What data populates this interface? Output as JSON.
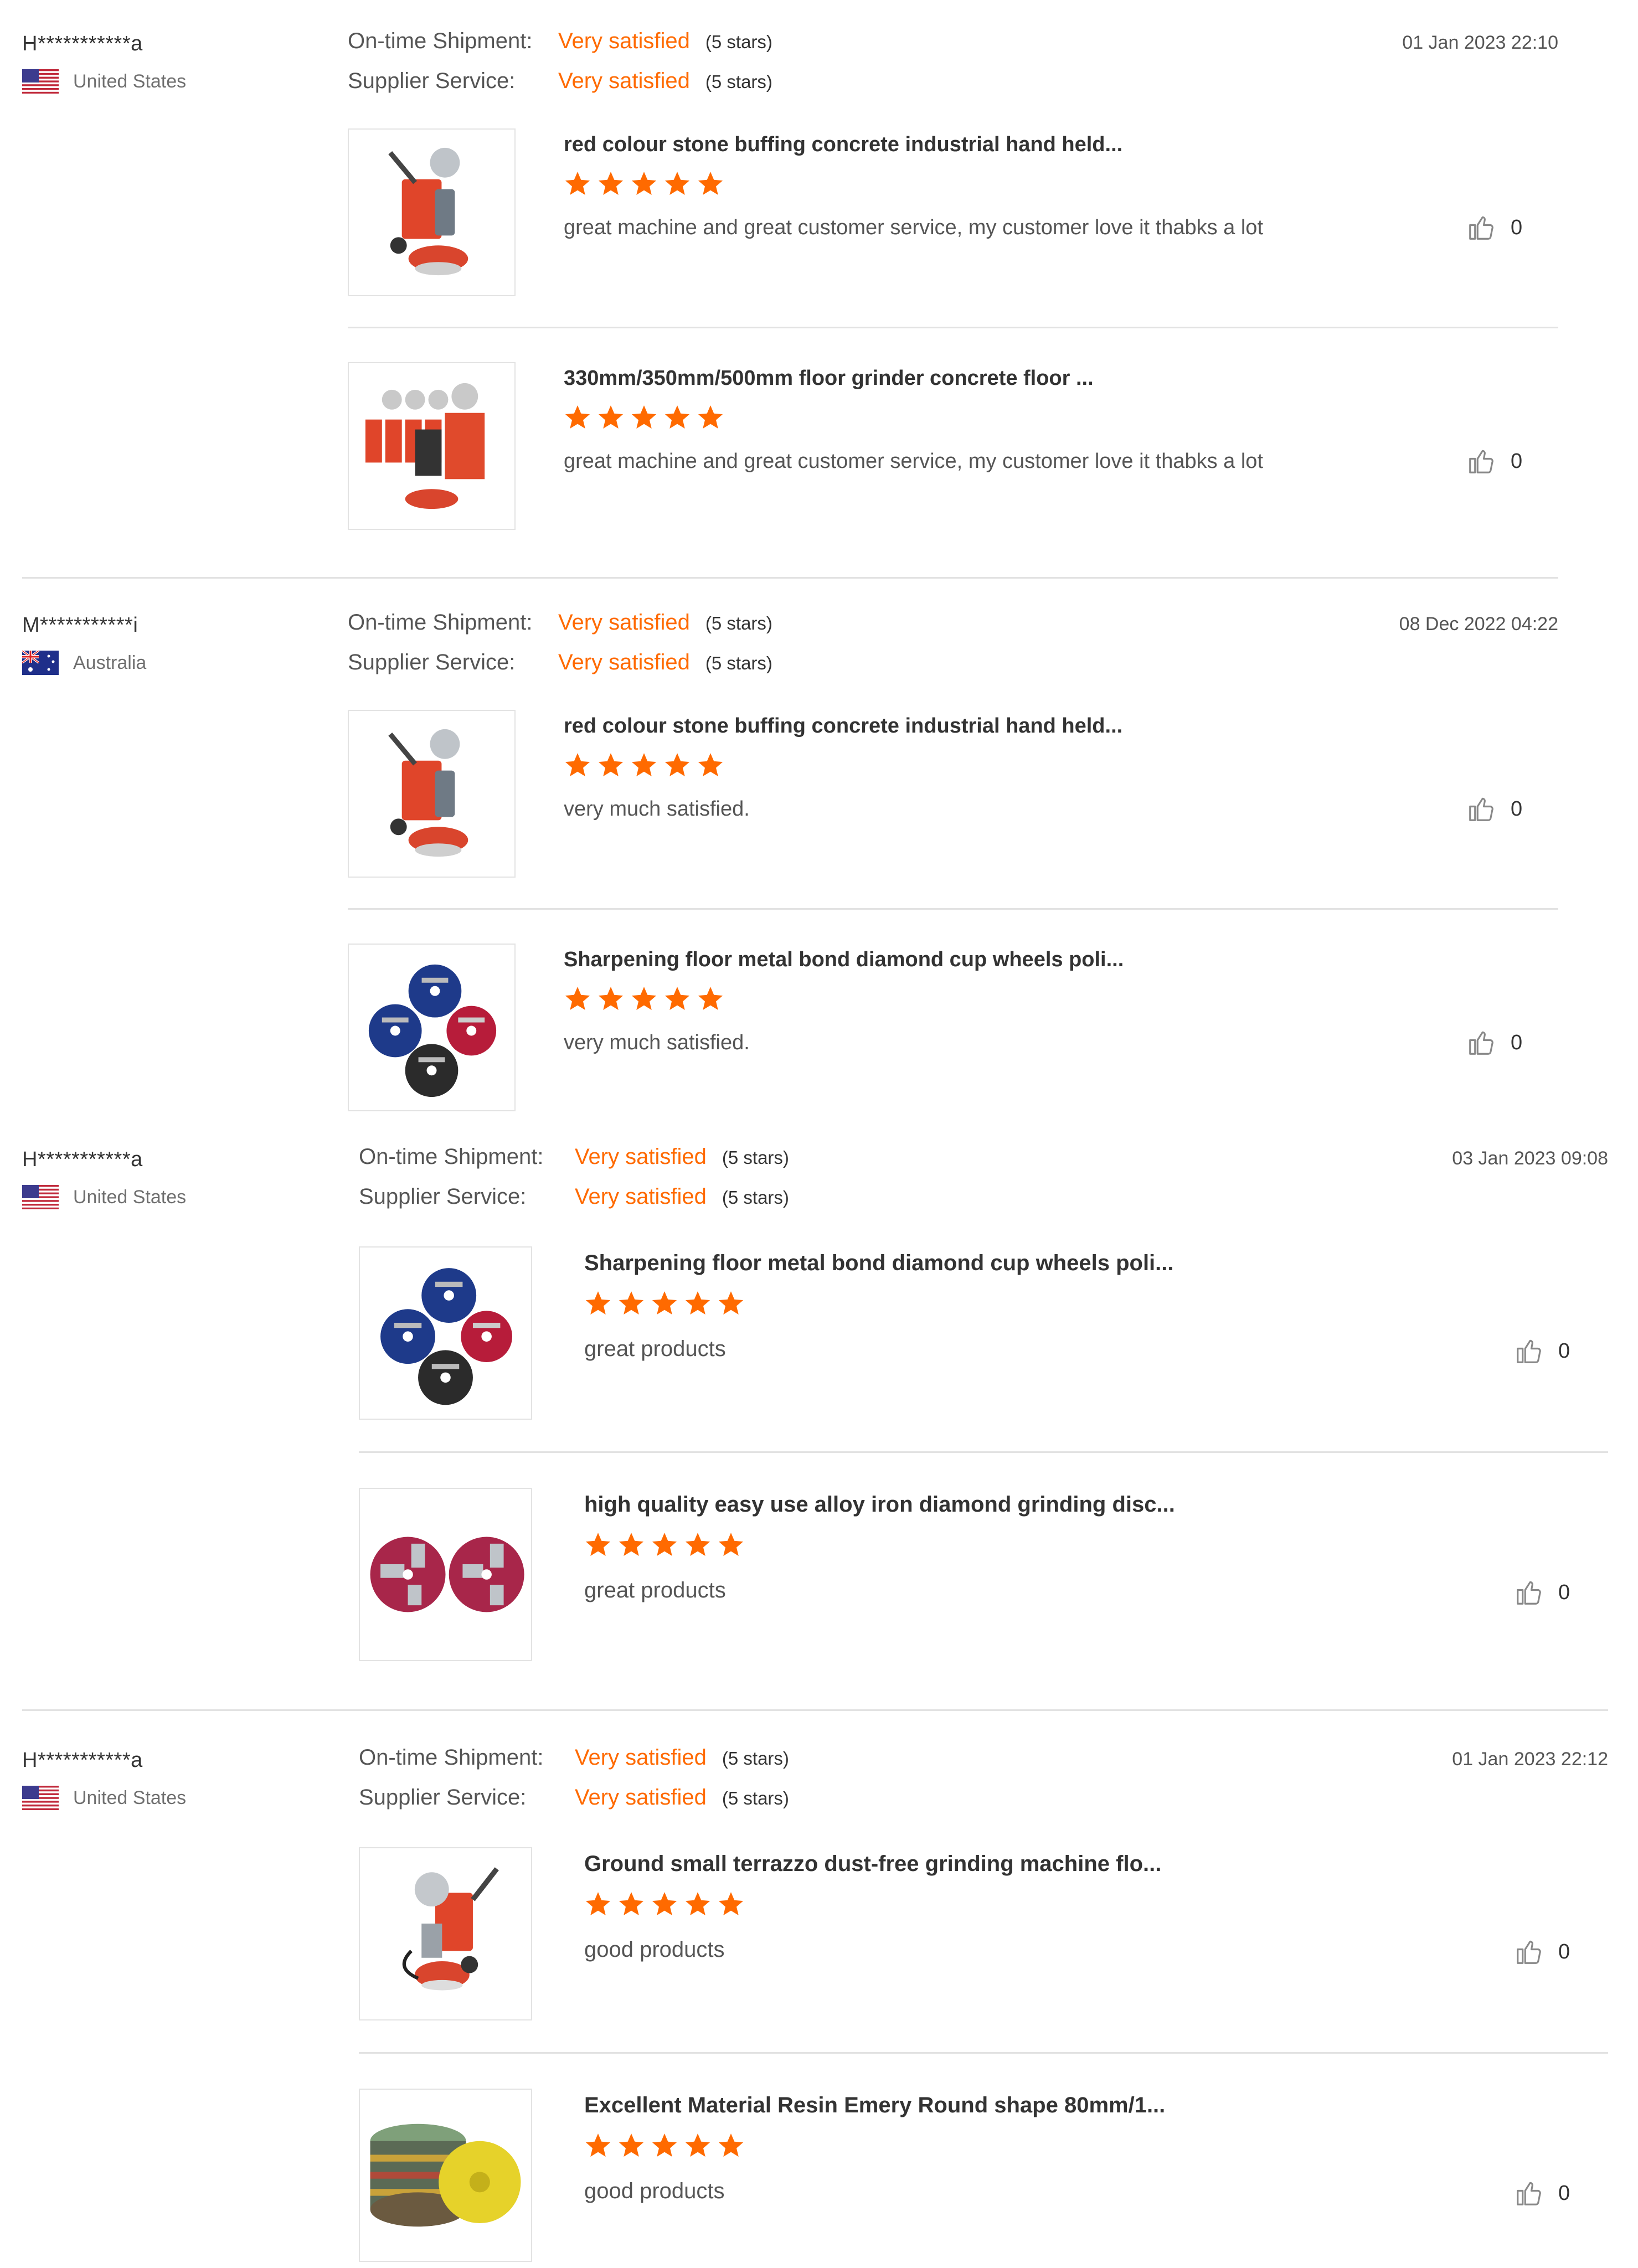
{
  "reviews": [
    {
      "user": "H***********a",
      "country": "United States",
      "flag": "us-flag",
      "date": "01 Jan 2023 22:10",
      "ontime_label": "On-time Shipment:",
      "ontime_value": "Very satisfied",
      "ontime_stars": "(5 stars)",
      "service_label": "Supplier Service:",
      "service_value": "Very satisfied",
      "service_stars": "(5 stars)",
      "products": [
        {
          "title": "red colour stone buffing concrete industrial hand held...",
          "rating": 5,
          "comment": "great machine and great customer service, my customer love it thabks a lot",
          "likes": "0",
          "image": "red-grinder-machine"
        },
        {
          "title": "330mm/350mm/500mm floor grinder concrete floor ...",
          "rating": 5,
          "comment": "great machine and great customer service, my customer love it thabks a lot",
          "likes": "0",
          "image": "row-of-grinders"
        }
      ]
    },
    {
      "user": "M***********i",
      "country": "Australia",
      "flag": "australia-flag",
      "date": "08 Dec 2022 04:22",
      "ontime_label": "On-time Shipment:",
      "ontime_value": "Very satisfied",
      "ontime_stars": "(5 stars)",
      "service_label": "Supplier Service:",
      "service_value": "Very satisfied",
      "service_stars": "(5 stars)",
      "products": [
        {
          "title": "red colour stone buffing concrete industrial hand held...",
          "rating": 5,
          "comment": "very much satisfied.",
          "likes": "0",
          "image": "red-grinder-machine"
        },
        {
          "title": "Sharpening floor metal bond diamond cup wheels poli...",
          "rating": 5,
          "comment": "very much satisfied.",
          "likes": "0",
          "image": "diamond-cup-wheels"
        }
      ]
    },
    {
      "user": "H***********a",
      "country": "United States",
      "flag": "us-flag",
      "date": "03 Jan 2023 09:08",
      "ontime_label": "On-time Shipment:",
      "ontime_value": "Very satisfied",
      "ontime_stars": "(5 stars)",
      "service_label": "Supplier Service:",
      "service_value": "Very satisfied",
      "service_stars": "(5 stars)",
      "products": [
        {
          "title": "Sharpening floor metal bond diamond cup wheels poli...",
          "rating": 5,
          "comment": "great products",
          "likes": "0",
          "image": "diamond-cup-wheels"
        },
        {
          "title": "high quality easy use alloy iron diamond grinding disc...",
          "rating": 5,
          "comment": "great products",
          "likes": "0",
          "image": "grinding-discs"
        }
      ]
    },
    {
      "user": "H***********a",
      "country": "United States",
      "flag": "us-flag",
      "date": "01 Jan 2023 22:12",
      "ontime_label": "On-time Shipment:",
      "ontime_value": "Very satisfied",
      "ontime_stars": "(5 stars)",
      "service_label": "Supplier Service:",
      "service_value": "Very satisfied",
      "service_stars": "(5 stars)",
      "products": [
        {
          "title": "Ground small terrazzo dust-free grinding machine flo...",
          "rating": 5,
          "comment": "good products",
          "likes": "0",
          "image": "terrazzo-grinder"
        },
        {
          "title": "Excellent Material Resin Emery Round shape 80mm/1...",
          "rating": 5,
          "comment": "good products",
          "likes": "0",
          "image": "polishing-pads"
        }
      ]
    }
  ],
  "colors": {
    "accent": "#ff6a00",
    "divider": "#e2e2e2",
    "text": "#333333",
    "muted": "#6f6f6f"
  }
}
